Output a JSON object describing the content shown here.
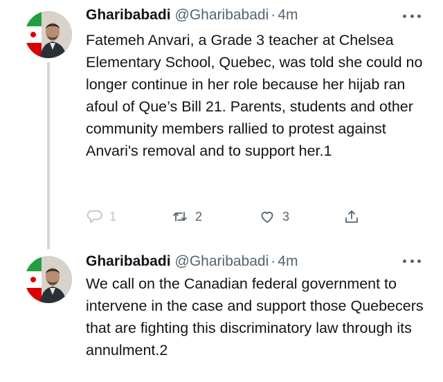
{
  "tweets": [
    {
      "author_name": "Gharibabadi",
      "handle": "@Gharibabadi",
      "separator": "·",
      "time": "4m",
      "text": "Fatemeh Anvari, a Grade 3 teacher at Chelsea Elementary School, Quebec, was told she could no longer continue in her role because her hijab ran afoul of Que’s Bill 21. Parents, students and other community members rallied to protest against Anvari's removal and to support her.1",
      "reply_count": "1",
      "retweet_count": "2",
      "like_count": "3"
    },
    {
      "author_name": "Gharibabadi",
      "handle": "@Gharibabadi",
      "separator": "·",
      "time": "4m",
      "text": "We call on the Canadian federal government to intervene in the case and support those Quebecers that are fighting this discriminatory law through its annulment.2"
    }
  ],
  "icons": {
    "more": "more-icon",
    "reply": "reply-icon",
    "retweet": "retweet-icon",
    "like": "like-icon",
    "share": "share-icon"
  },
  "colors": {
    "text": "#0f1419",
    "secondary": "#536471",
    "thread_line": "#cfd9de",
    "flag_green": "#239f40",
    "flag_red": "#da0000"
  }
}
